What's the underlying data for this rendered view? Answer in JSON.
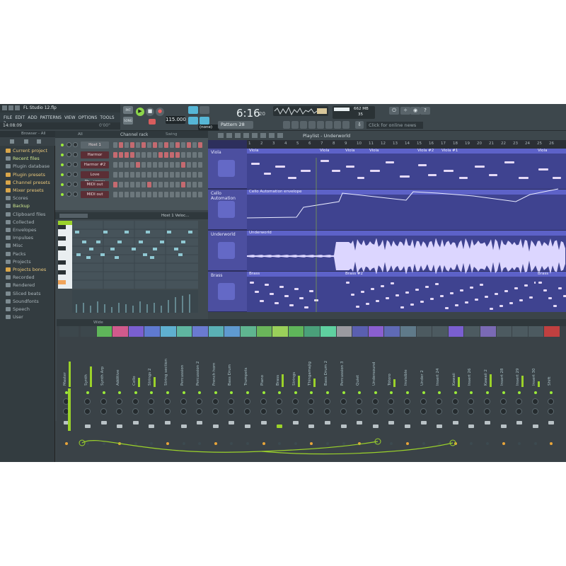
{
  "window": {
    "title": "FL Studio 12.flp"
  },
  "menu": [
    "FILE",
    "EDIT",
    "ADD",
    "PATTERNS",
    "VIEW",
    "OPTIONS",
    "TOOLS",
    "?"
  ],
  "hint": {
    "time": "14:08:09",
    "right": "0'00\""
  },
  "transport": {
    "tempo": "115.000",
    "time": "6:16",
    "time_sub": "20",
    "pattern": "Pattern 28",
    "snap": "(none)",
    "memory": "662 MB",
    "cpu": "35",
    "news": "Click for online news",
    "mode": "PAT",
    "song": "SONG"
  },
  "browser": {
    "header": "Browser - All",
    "items": [
      {
        "label": "Current project",
        "hl": true
      },
      {
        "label": "Recent files",
        "hl": false,
        "green": true
      },
      {
        "label": "Plugin database",
        "hl": false
      },
      {
        "label": "Plugin presets",
        "hl": true
      },
      {
        "label": "Channel presets",
        "hl": true
      },
      {
        "label": "Mixer presets",
        "hl": true
      },
      {
        "label": "Scores",
        "hl": false
      },
      {
        "label": "Backup",
        "hl": false,
        "green": true
      },
      {
        "label": "Clipboard files",
        "hl": false
      },
      {
        "label": "Collected",
        "hl": false
      },
      {
        "label": "Envelopes",
        "hl": false
      },
      {
        "label": "Impulses",
        "hl": false
      },
      {
        "label": "Misc",
        "hl": false
      },
      {
        "label": "Packs",
        "hl": false
      },
      {
        "label": "Projects",
        "hl": false
      },
      {
        "label": "Projects bones",
        "hl": true
      },
      {
        "label": "Recorded",
        "hl": false
      },
      {
        "label": "Rendered",
        "hl": false
      },
      {
        "label": "Sliced beats",
        "hl": false
      },
      {
        "label": "Soundfonts",
        "hl": false
      },
      {
        "label": "Speech",
        "hl": false
      },
      {
        "label": "User",
        "hl": false
      }
    ]
  },
  "channel_rack": {
    "header": "Channel rack",
    "filter": "All",
    "swing": "Swing",
    "channels": [
      "Host 1",
      "Harmor",
      "Harmor #2",
      "Love Ph...uency",
      "MIDI out",
      "MIDI out"
    ]
  },
  "piano_roll": {
    "header": "Host 1  Veloc..."
  },
  "playlist": {
    "header": "Playlist - Underworld",
    "ruler": [
      "1",
      "2",
      "3",
      "4",
      "5",
      "6",
      "7",
      "8",
      "9",
      "10",
      "11",
      "12",
      "13",
      "14",
      "15",
      "16",
      "17",
      "18",
      "19",
      "20",
      "21",
      "22",
      "23",
      "24",
      "25",
      "26"
    ],
    "tracks": [
      {
        "name": "Viola",
        "clips": [
          "Viola",
          "Viola",
          "Viola",
          "Viola",
          "Viola #2",
          "Viola #1",
          "Viola"
        ]
      },
      {
        "name": "Cello Automation",
        "clips": [
          "Cello Automation envelope"
        ]
      },
      {
        "name": "Underworld",
        "clips": [
          "Underworld"
        ]
      },
      {
        "name": "Brass",
        "clips": [
          "Brass",
          "Brass #2",
          "Brass"
        ]
      }
    ]
  },
  "mixer": {
    "header": "Wide",
    "strips": [
      "Master",
      "Synth",
      "Synth Arp",
      "Additive",
      "Cello",
      "Strings 2",
      "String section",
      "Percussion",
      "Percussion 2",
      "French horn",
      "Bass Drum",
      "Trumpets",
      "Piano",
      "Brass",
      "Strings",
      "Thingamajig",
      "Bass Drum 2",
      "Percussion 3",
      "Quiet",
      "Undersound",
      "Totoro",
      "Invisible",
      "Under 2",
      "Insert 24",
      "Kawaii",
      "Insert 26",
      "Kawaii 2",
      "Insert 28",
      "Insert 29",
      "Insert 30",
      "Shift"
    ],
    "colors": [
      "#3c474c",
      "#3c474c",
      "#5fb55a",
      "#d05a8c",
      "#7a5fd0",
      "#5f7ad0",
      "#5fb0d0",
      "#5fb5a0",
      "#6a7ad0",
      "#5ab0b5",
      "#5f9ad0",
      "#5fb590",
      "#6ab55a",
      "#9ad05a",
      "#5fb55a",
      "#4aa07a",
      "#5fd0a0",
      "#9a9aa0",
      "#5a5fb0",
      "#8a5fd0",
      "#5f6ab5",
      "#5f7a8a",
      "#4c5a60",
      "#4c5a60",
      "#7a5fd0",
      "#4c5a60",
      "#7a6ab5",
      "#4c5a60",
      "#4c5a60",
      "#4c5a60",
      "#c04040"
    ]
  }
}
